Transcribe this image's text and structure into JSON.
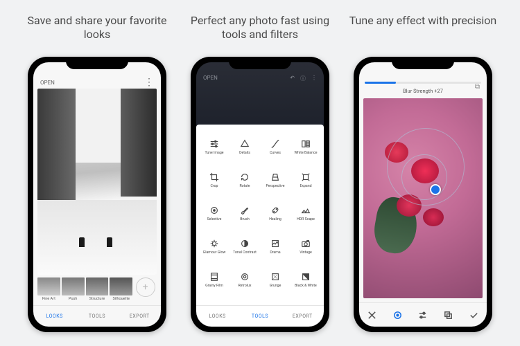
{
  "panels": [
    {
      "caption": "Save and share your favorite looks"
    },
    {
      "caption": "Perfect any photo fast using tools and filters"
    },
    {
      "caption": "Tune any effect with precision"
    }
  ],
  "phone1": {
    "open_label": "OPEN",
    "looks": [
      {
        "label": "Fine Art"
      },
      {
        "label": "Push"
      },
      {
        "label": "Structure"
      },
      {
        "label": "Silhouette"
      }
    ],
    "tabs": {
      "looks": "LOOKS",
      "tools": "TOOLS",
      "export": "EXPORT"
    }
  },
  "phone2": {
    "open_label": "OPEN",
    "tools": [
      {
        "label": "Tune Image"
      },
      {
        "label": "Details"
      },
      {
        "label": "Curves"
      },
      {
        "label": "White Balance"
      },
      {
        "label": "Crop"
      },
      {
        "label": "Rotate"
      },
      {
        "label": "Perspective"
      },
      {
        "label": "Expand"
      },
      {
        "label": "Selective"
      },
      {
        "label": "Brush"
      },
      {
        "label": "Healing"
      },
      {
        "label": "HDR Scape"
      },
      {
        "label": "Glamour Glow"
      },
      {
        "label": "Tonal Contrast"
      },
      {
        "label": "Drama"
      },
      {
        "label": "Vintage"
      },
      {
        "label": "Grainy Film"
      },
      {
        "label": "Retrolux"
      },
      {
        "label": "Grunge"
      },
      {
        "label": "Black & White"
      }
    ],
    "tabs": {
      "looks": "LOOKS",
      "tools": "TOOLS",
      "export": "EXPORT"
    }
  },
  "phone3": {
    "effect_label": "Blur Strength +27",
    "progress_pct": 27
  }
}
